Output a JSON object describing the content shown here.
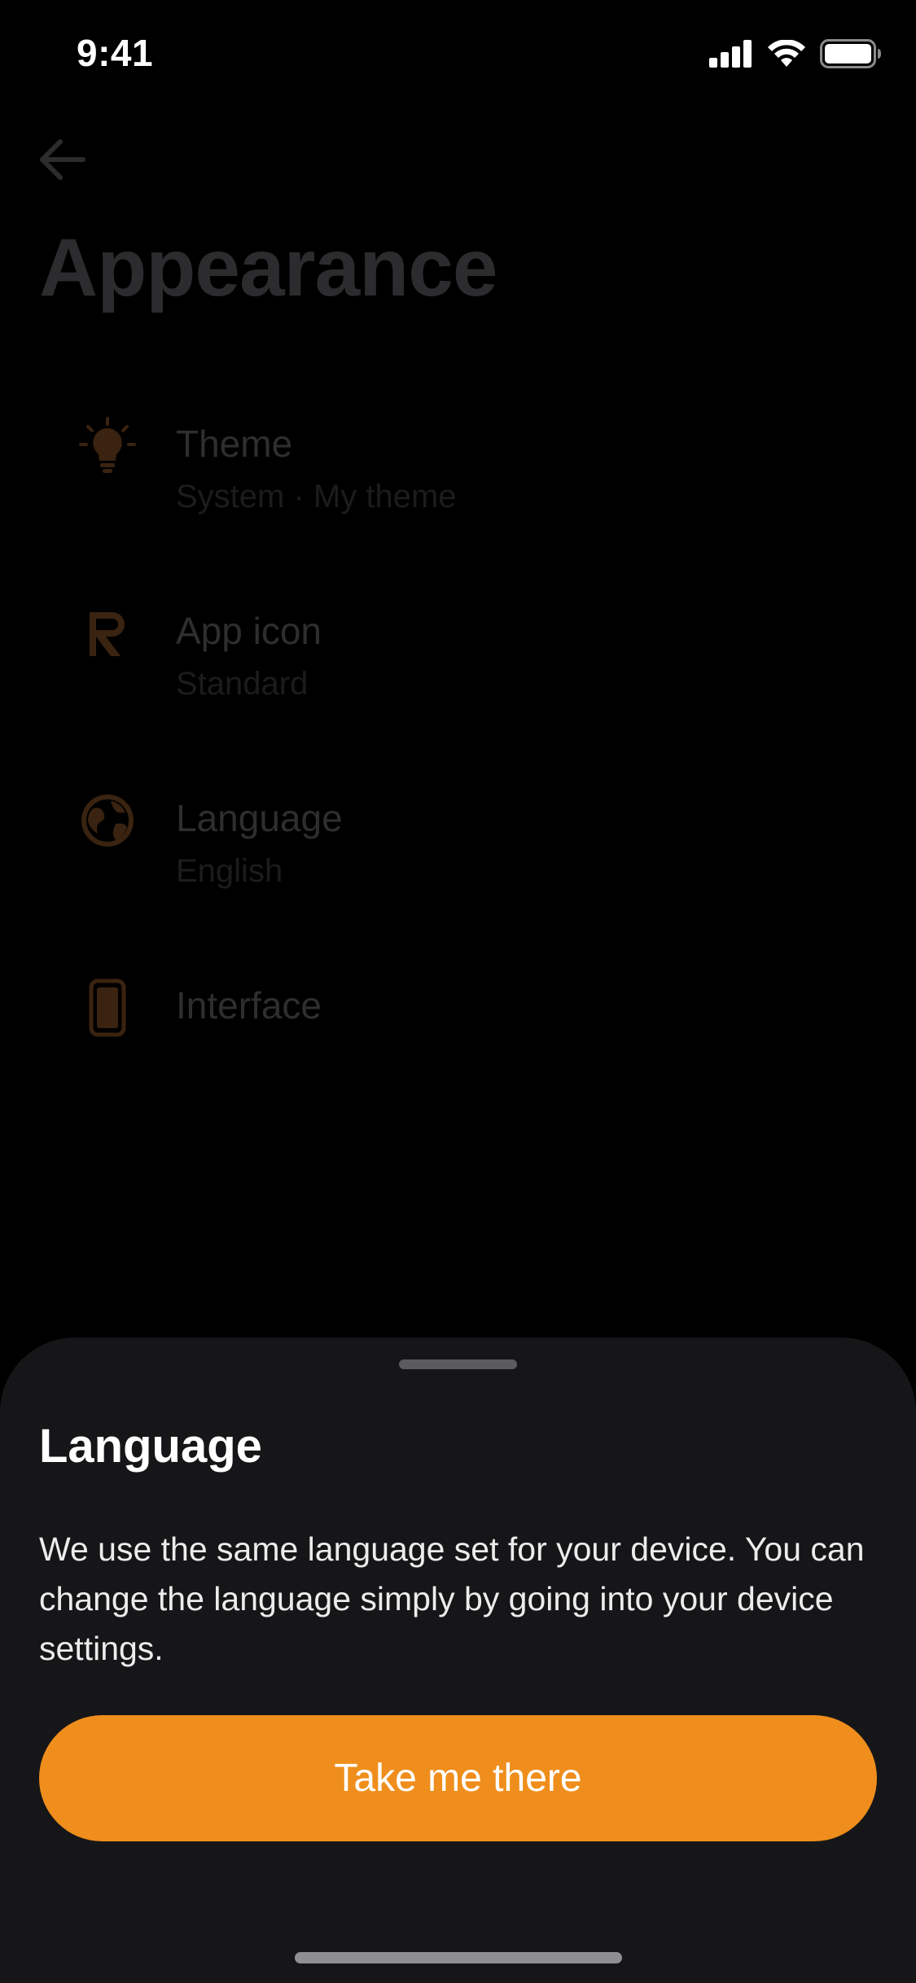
{
  "status_bar": {
    "time": "9:41",
    "icons": [
      "cellular-signal-icon",
      "wifi-icon",
      "battery-icon"
    ]
  },
  "page": {
    "back_icon": "arrow-left-icon",
    "title": "Appearance",
    "items": [
      {
        "icon": "lightbulb-icon",
        "label": "Theme",
        "sublabel": "System · My theme"
      },
      {
        "icon": "app-r-logo-icon",
        "label": "App icon",
        "sublabel": "Standard"
      },
      {
        "icon": "globe-icon",
        "label": "Language",
        "sublabel": "English"
      },
      {
        "icon": "phone-device-icon",
        "label": "Interface"
      }
    ]
  },
  "sheet": {
    "title": "Language",
    "body": "We use the same language set for your device. You can change the language simply by going into your device settings.",
    "button_label": "Take me there"
  },
  "colors": {
    "accent": "#ef8e1c",
    "dim_accent": "#3a2310",
    "sheet_bg": "#161618",
    "background": "#000000"
  }
}
